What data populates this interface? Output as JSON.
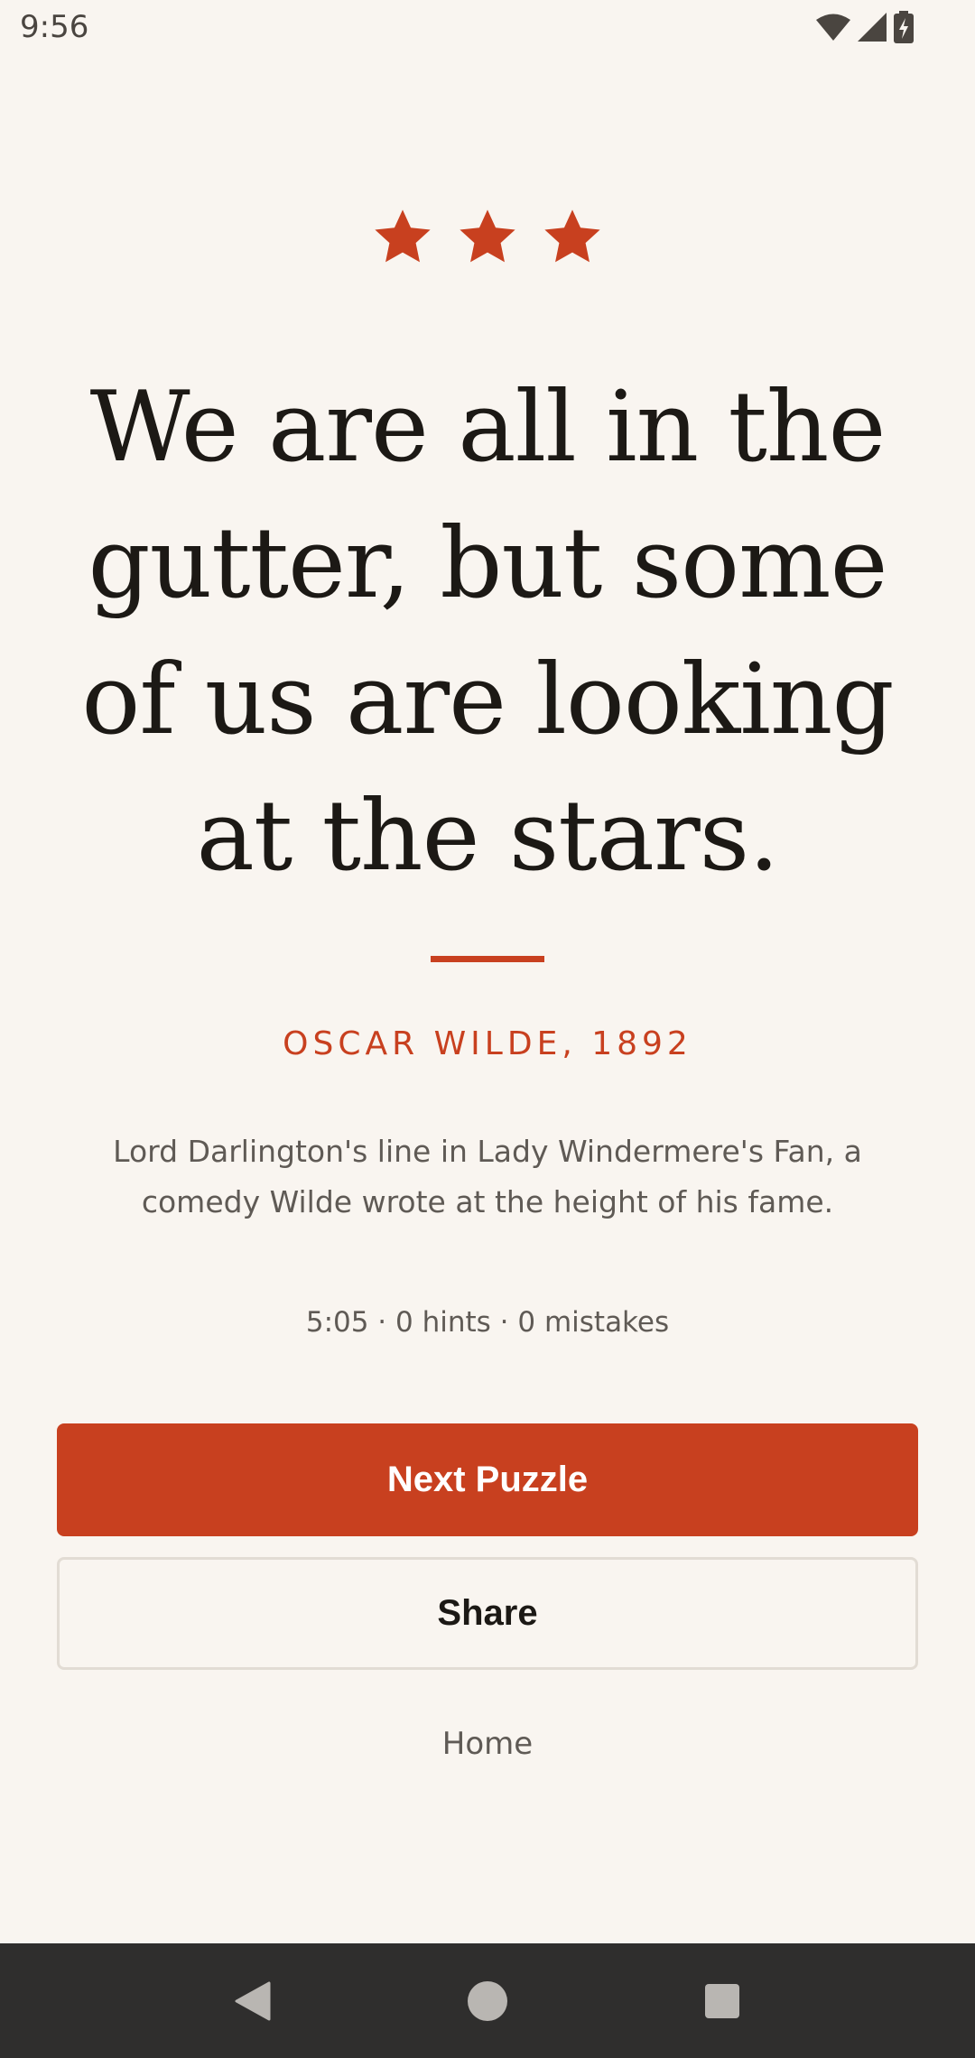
{
  "status_bar": {
    "time": "9:56",
    "icons": [
      "wifi-icon",
      "signal-icon",
      "battery-charging-icon"
    ]
  },
  "rating": {
    "stars": 3,
    "max_stars": 3,
    "color": "#c8401f"
  },
  "quote": {
    "text": "We are all in the gutter, but some of us are looking at the stars.",
    "author": "OSCAR WILDE, 1892",
    "description": "Lord Darlington's line in Lady Windermere's Fan, a comedy Wilde wrote at the height of his fame."
  },
  "stats": {
    "summary": "5:05 · 0 hints · 0 mistakes"
  },
  "actions": {
    "next_label": "Next Puzzle",
    "share_label": "Share",
    "home_label": "Home"
  },
  "colors": {
    "accent": "#c8401f",
    "background": "#f9f5f0",
    "text": "#1c1915",
    "nav_bar": "#2f2e2d"
  },
  "nav_bar": {
    "buttons": [
      "back-icon",
      "home-icon",
      "recents-icon"
    ]
  }
}
